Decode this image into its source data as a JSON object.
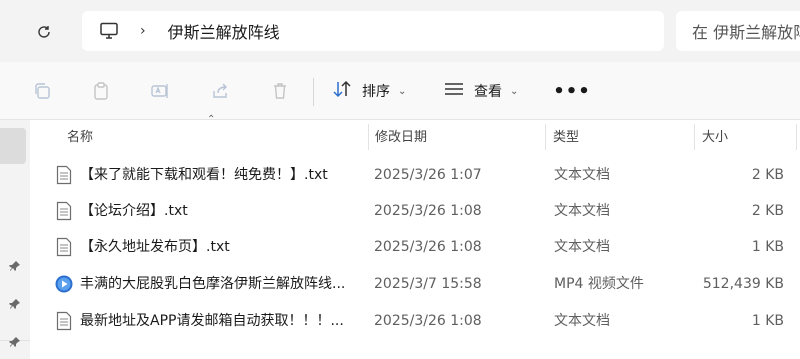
{
  "address_bar": {
    "breadcrumb": "伊斯兰解放阵线",
    "search_placeholder": "在 伊斯兰解放阵线 中搜索"
  },
  "toolbar": {
    "sort_label": "排序",
    "view_label": "查看",
    "more_label": "•••"
  },
  "columns": {
    "name": "名称",
    "modified": "修改日期",
    "type": "类型",
    "size": "大小"
  },
  "files": [
    {
      "name": "【来了就能下载和观看！纯免费！】.txt",
      "modified": "2025/3/26 1:07",
      "type": "文本文档",
      "size": "2 KB",
      "icon": "text-file-icon"
    },
    {
      "name": "【论坛介绍】.txt",
      "modified": "2025/3/26 1:08",
      "type": "文本文档",
      "size": "2 KB",
      "icon": "text-file-icon"
    },
    {
      "name": "【永久地址发布页】.txt",
      "modified": "2025/3/26 1:08",
      "type": "文本文档",
      "size": "1 KB",
      "icon": "text-file-icon"
    },
    {
      "name": "丰满的大屁股乳白色摩洛伊斯兰解放阵线...",
      "modified": "2025/3/7 15:58",
      "type": "MP4 视频文件",
      "size": "512,439 KB",
      "icon": "video-file-icon"
    },
    {
      "name": "最新地址及APP请发邮箱自动获取！！！...",
      "modified": "2025/3/26 1:08",
      "type": "文本文档",
      "size": "1 KB",
      "icon": "text-file-icon"
    }
  ],
  "colors": {
    "accent": "#2b6fcf",
    "toolbar_bg": "#f9f9f9",
    "address_bg": "#f3f3f3"
  }
}
